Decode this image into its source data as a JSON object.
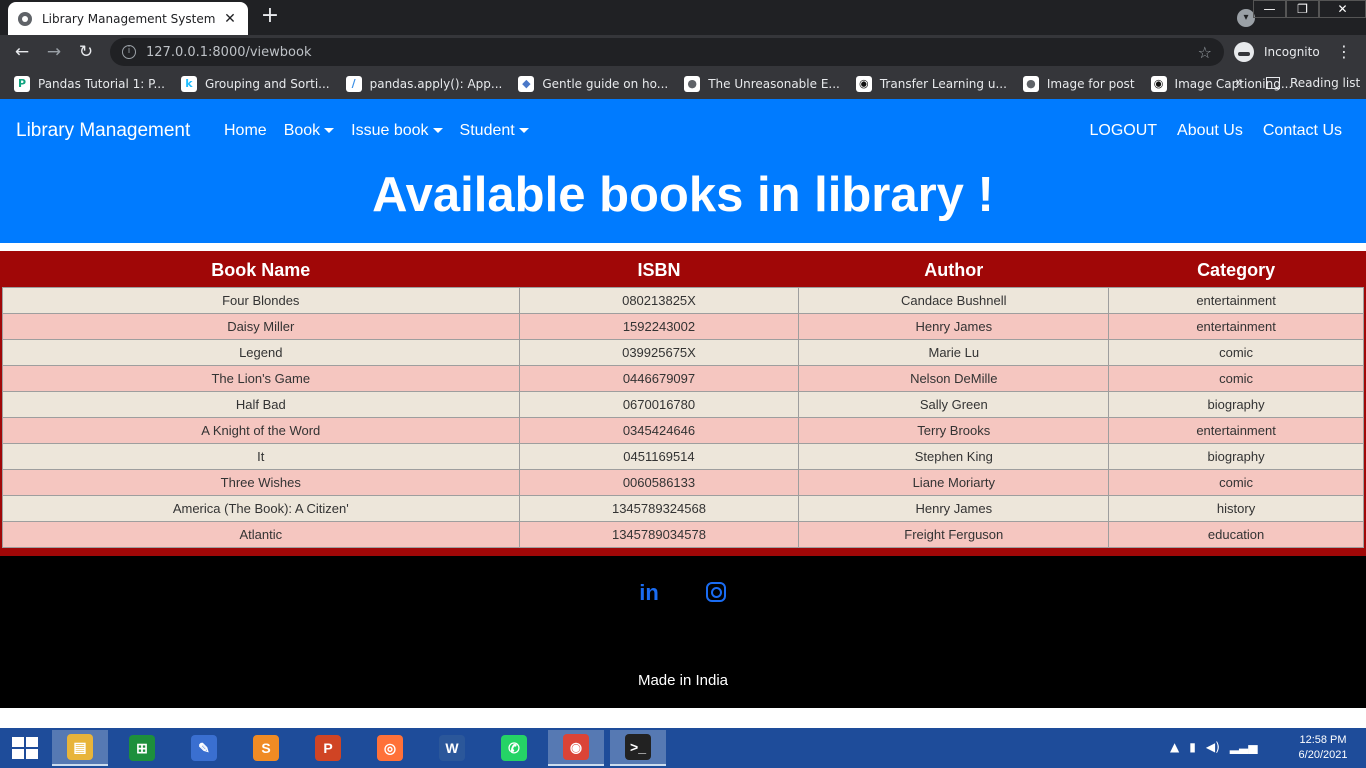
{
  "browser": {
    "tab_title": "Library Management System",
    "tab_close": "✕",
    "new_tab": "+",
    "url": "127.0.0.1:8000/viewbook",
    "profile_label": "Incognito",
    "window_buttons": [
      "—",
      "❐",
      "✕"
    ],
    "bookmarks": [
      {
        "label": "Pandas Tutorial 1: P...",
        "icon": "P",
        "color": "#10a37f"
      },
      {
        "label": "Grouping and Sorti...",
        "icon": "k",
        "color": "#20beff"
      },
      {
        "label": "pandas.apply(): App...",
        "icon": "∕",
        "color": "#3b8fe6"
      },
      {
        "label": "Gentle guide on ho...",
        "icon": "◆",
        "color": "#4a78c8"
      },
      {
        "label": "The Unreasonable E...",
        "icon": "●",
        "color": "#5f6368"
      },
      {
        "label": "Transfer Learning u...",
        "icon": "◉",
        "color": "#111111"
      },
      {
        "label": "Image for post",
        "icon": "●",
        "color": "#5f6368"
      },
      {
        "label": "Image Captioning...",
        "icon": "◉",
        "color": "#111111"
      }
    ],
    "bookmarks_more": "»",
    "reading_list": "Reading list"
  },
  "nav": {
    "brand": "Library Management",
    "links": [
      {
        "label": "Home",
        "dropdown": false
      },
      {
        "label": "Book",
        "dropdown": true
      },
      {
        "label": "Issue book",
        "dropdown": true
      },
      {
        "label": "Student",
        "dropdown": true
      }
    ],
    "right_links": [
      "LOGOUT",
      "About Us",
      "Contact Us"
    ]
  },
  "hero": {
    "title": "Available books in library !"
  },
  "table": {
    "headers": [
      "Book Name",
      "ISBN",
      "Author",
      "Category"
    ],
    "rows": [
      [
        "Four Blondes",
        "080213825X",
        "Candace Bushnell",
        "entertainment"
      ],
      [
        "Daisy Miller",
        "1592243002",
        "Henry James",
        "entertainment"
      ],
      [
        "Legend",
        "039925675X",
        "Marie Lu",
        "comic"
      ],
      [
        "The Lion's Game",
        "0446679097",
        "Nelson DeMille",
        "comic"
      ],
      [
        "Half Bad",
        "0670016780",
        "Sally Green",
        "biography"
      ],
      [
        "A Knight of the Word",
        "0345424646",
        "Terry Brooks",
        "entertainment"
      ],
      [
        "It",
        "0451169514",
        "Stephen King",
        "biography"
      ],
      [
        "Three Wishes",
        "0060586133",
        "Liane Moriarty",
        "comic"
      ],
      [
        "America (The Book): A Citizen'",
        "1345789324568",
        "Henry James",
        "history"
      ],
      [
        "Atlantic",
        "1345789034578",
        "Freight Ferguson",
        "education"
      ]
    ]
  },
  "footer": {
    "linkedin_label": "in",
    "made_in": "Made in India"
  },
  "taskbar": {
    "apps": [
      {
        "name": "file-explorer",
        "glyph": "▤",
        "color": "#e8b43a",
        "active": true
      },
      {
        "name": "store",
        "glyph": "⊞",
        "color": "#1d8f3c",
        "active": false
      },
      {
        "name": "video-editor",
        "glyph": "✎",
        "color": "#3a6fd0",
        "active": false
      },
      {
        "name": "sublime-text",
        "glyph": "S",
        "color": "#f08b24",
        "active": false
      },
      {
        "name": "powerpoint",
        "glyph": "P",
        "color": "#d04424",
        "active": false
      },
      {
        "name": "firefox",
        "glyph": "◎",
        "color": "#ff7139",
        "active": false
      },
      {
        "name": "word",
        "glyph": "W",
        "color": "#2b579a",
        "active": false
      },
      {
        "name": "whatsapp",
        "glyph": "✆",
        "color": "#25d366",
        "active": false
      },
      {
        "name": "chrome",
        "glyph": "◉",
        "color": "#db4437",
        "active": true
      },
      {
        "name": "terminal",
        "glyph": ">_",
        "color": "#222222",
        "active": true
      }
    ],
    "time": "12:58 PM",
    "date": "6/20/2021"
  }
}
